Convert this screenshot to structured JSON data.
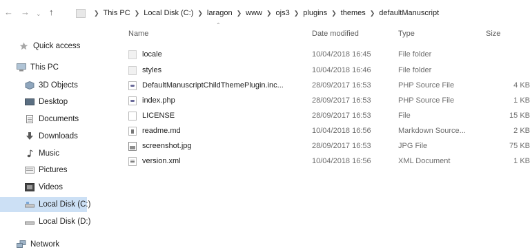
{
  "address": {
    "back_icon": "back-arrow-icon",
    "forward_icon": "forward-arrow-icon",
    "up_icon": "up-arrow-icon",
    "crumbs": [
      "This PC",
      "Local Disk (C:)",
      "laragon",
      "www",
      "ojs3",
      "plugins",
      "themes",
      "defaultManuscript"
    ]
  },
  "sidebar": {
    "items": [
      {
        "label": "Quick access",
        "icon": "star-icon"
      },
      {
        "label": "This PC",
        "icon": "computer-icon"
      },
      {
        "label": "3D Objects",
        "icon": "cube-icon"
      },
      {
        "label": "Desktop",
        "icon": "desktop-icon"
      },
      {
        "label": "Documents",
        "icon": "document-icon"
      },
      {
        "label": "Downloads",
        "icon": "download-icon"
      },
      {
        "label": "Music",
        "icon": "music-icon"
      },
      {
        "label": "Pictures",
        "icon": "pictures-icon"
      },
      {
        "label": "Videos",
        "icon": "video-icon"
      },
      {
        "label": "Local Disk (C:)",
        "icon": "drive-icon",
        "selected": true
      },
      {
        "label": "Local Disk (D:)",
        "icon": "drive-icon"
      },
      {
        "label": "Network",
        "icon": "network-icon"
      }
    ]
  },
  "columns": {
    "name": "Name",
    "date": "Date modified",
    "type": "Type",
    "size": "Size"
  },
  "files": [
    {
      "name": "locale",
      "date": "10/04/2018 16:45",
      "type": "File folder",
      "size": "",
      "icon": "folder"
    },
    {
      "name": "styles",
      "date": "10/04/2018 16:46",
      "type": "File folder",
      "size": "",
      "icon": "folder"
    },
    {
      "name": "DefaultManuscriptChildThemePlugin.inc...",
      "date": "28/09/2017 16:53",
      "type": "PHP Source File",
      "size": "4 KB",
      "icon": "php"
    },
    {
      "name": "index.php",
      "date": "28/09/2017 16:53",
      "type": "PHP Source File",
      "size": "1 KB",
      "icon": "php"
    },
    {
      "name": "LICENSE",
      "date": "28/09/2017 16:53",
      "type": "File",
      "size": "15 KB",
      "icon": "file"
    },
    {
      "name": "readme.md",
      "date": "10/04/2018 16:56",
      "type": "Markdown Source...",
      "size": "2 KB",
      "icon": "md"
    },
    {
      "name": "screenshot.jpg",
      "date": "28/09/2017 16:53",
      "type": "JPG File",
      "size": "75 KB",
      "icon": "jpg"
    },
    {
      "name": "version.xml",
      "date": "10/04/2018 16:56",
      "type": "XML Document",
      "size": "1 KB",
      "icon": "xml"
    }
  ]
}
